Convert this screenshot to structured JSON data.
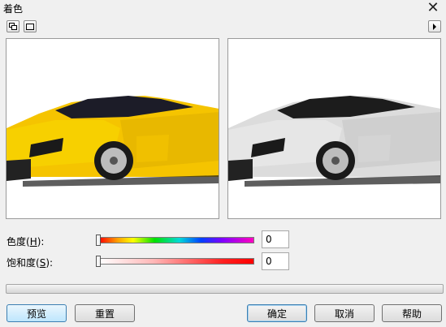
{
  "window": {
    "title": "着色",
    "close_icon": "close-icon"
  },
  "toolbar": {
    "left_buttons": [
      "show-before-after-icon",
      "single-preview-icon"
    ],
    "right_button": "expand-arrow-icon"
  },
  "previews": {
    "original": {
      "image": "yellow sports car",
      "body_color": "#f5c400"
    },
    "result": {
      "image": "grayscale sports car",
      "body_color": "#dcdcdc"
    }
  },
  "hue": {
    "label_prefix": "色度(",
    "label_key": "H",
    "label_suffix": "):",
    "value": "0"
  },
  "saturation": {
    "label_prefix": "饱和度(",
    "label_key": "S",
    "label_suffix": "):",
    "value": "0"
  },
  "buttons": {
    "preview": "预览",
    "reset": "重置",
    "ok": "确定",
    "cancel": "取消",
    "help": "帮助"
  },
  "colors": {
    "primary_button_border": "#3c7fb1",
    "primary_button_fill": "#bee6fd"
  }
}
